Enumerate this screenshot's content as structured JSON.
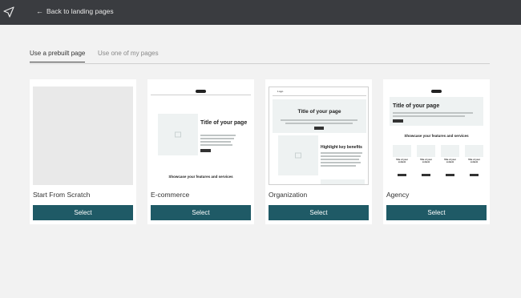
{
  "topbar": {
    "back_label": "Back to landing pages"
  },
  "tabs": [
    {
      "label": "Use a prebuilt page",
      "active": true
    },
    {
      "label": "Use one of my pages",
      "active": false
    }
  ],
  "cards": [
    {
      "name": "Start From Scratch",
      "select_label": "Select"
    },
    {
      "name": "E-commerce",
      "select_label": "Select",
      "thumb": {
        "title": "Title of your page",
        "heading": "Showcase your features and services"
      }
    },
    {
      "name": "Organization",
      "select_label": "Select",
      "thumb": {
        "logo": "Logo",
        "title": "Title of your page",
        "heading": "Highlight key benefits"
      }
    },
    {
      "name": "Agency",
      "select_label": "Select",
      "thumb": {
        "title": "Title of your page",
        "heading": "Showcase your features and services",
        "item_title": "Title of your content"
      }
    }
  ],
  "colors": {
    "topbar": "#3a3c40",
    "accent": "#1f5a66",
    "background": "#f2f2f2"
  }
}
